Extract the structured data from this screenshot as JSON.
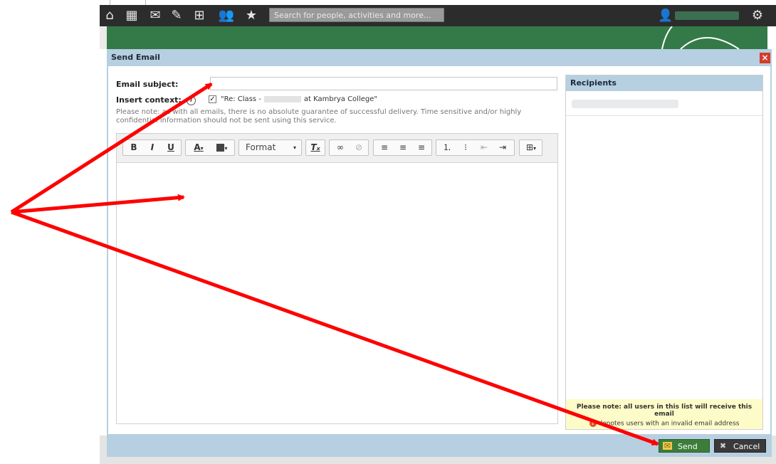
{
  "nav": {
    "search_placeholder": "Search for people, activities and more..."
  },
  "dialog": {
    "title": "Send Email",
    "close_glyph": "×"
  },
  "form": {
    "subject_label": "Email subject:",
    "subject_value": "",
    "context_label": "Insert context:",
    "context_prefix": "\"Re: Class -",
    "context_suffix": "at Kambrya College\"",
    "context_checked": true,
    "note": "Please note: as with all emails, there is no absolute guarantee of successful delivery. Time sensitive and/or highly confidential information should not be sent using this service."
  },
  "toolbar": {
    "bold": "B",
    "italic": "I",
    "underline": "U",
    "text_color": "A",
    "format_label": "Format"
  },
  "recipients": {
    "header": "Recipients",
    "note_line1": "Please note: all users in this list will receive this email",
    "note_line2": "denotes users with an invalid email address"
  },
  "footer": {
    "send_label": "Send",
    "cancel_label": "Cancel"
  },
  "colors": {
    "navbar": "#2c2c2c",
    "banner": "#347a48",
    "dialog_frame": "#b6cfe1",
    "send_button": "#3c7d3a",
    "cancel_button": "#3a3a3a",
    "close_button": "#d53a2b",
    "annotation_arrow": "#ff0000",
    "recipients_note_bg": "#fdfbc8"
  }
}
